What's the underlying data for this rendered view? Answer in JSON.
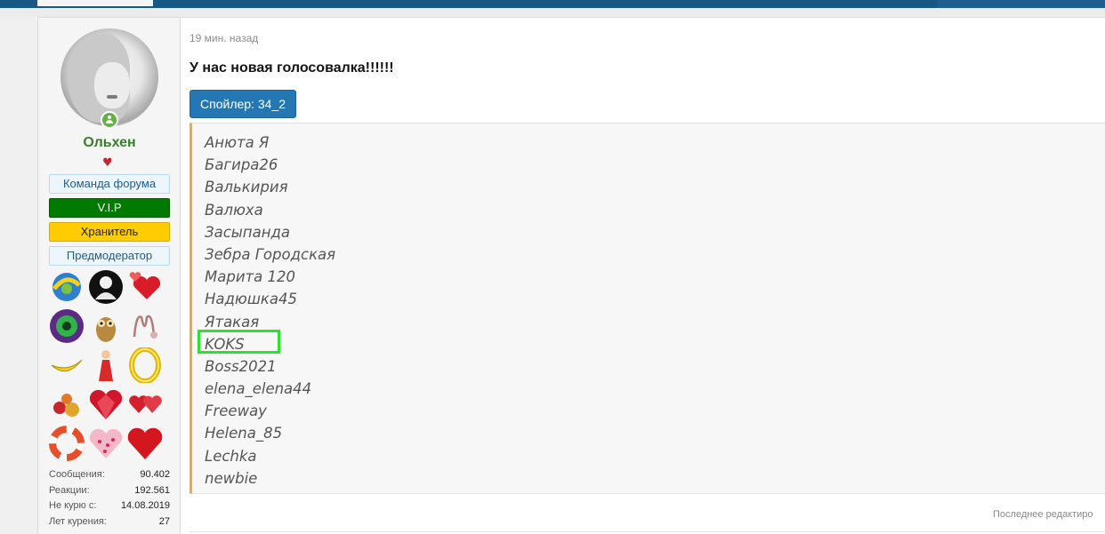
{
  "post": {
    "time": "19 мин. назад",
    "headline": "У нас новая голосовалка!!!!!!",
    "spoiler_label": "Спойлер: 34_2",
    "names": [
      "Анюта Я",
      "Багира26",
      "Валькирия",
      "Валюха",
      "Засыпанда",
      "Зебра Городская",
      "Марита 120",
      "Надюшка45",
      "Ятакая",
      "KOKS",
      "Boss2021",
      "elena_elena44",
      "Freeway",
      "Helena_85",
      "Lechka",
      "newbie"
    ],
    "highlighted_name": "KOKS",
    "edited_text": "Последнее редактиро"
  },
  "user": {
    "name": "Ольхен",
    "name_color": "#3a7d2c",
    "badges": [
      "Команда форума",
      "V.I.P",
      "Хранитель",
      "Предмодератор"
    ],
    "trophy_icons": [
      "sports-badge-icon",
      "silhouette-icon",
      "hearts-icon",
      "eye-icon",
      "owl-icon",
      "monogram-icon",
      "banana-icon",
      "lady-icon",
      "gold-ring-icon",
      "rose-hearts-icon",
      "ruby-heart-icon",
      "twin-hearts-icon",
      "lifebuoy-icon",
      "dotted-heart-icon",
      "red-heart-icon"
    ],
    "stats": [
      {
        "label": "Сообщения:",
        "value": "90.402"
      },
      {
        "label": "Реакции:",
        "value": "192.561"
      },
      {
        "label": "Не курю с:",
        "value": "14.08.2019"
      },
      {
        "label": "Лет курения:",
        "value": "27"
      }
    ]
  },
  "colors": {
    "accent": "#2577b1",
    "highlight_box": "#2ce32c",
    "quote_border": "#f4a93d"
  }
}
